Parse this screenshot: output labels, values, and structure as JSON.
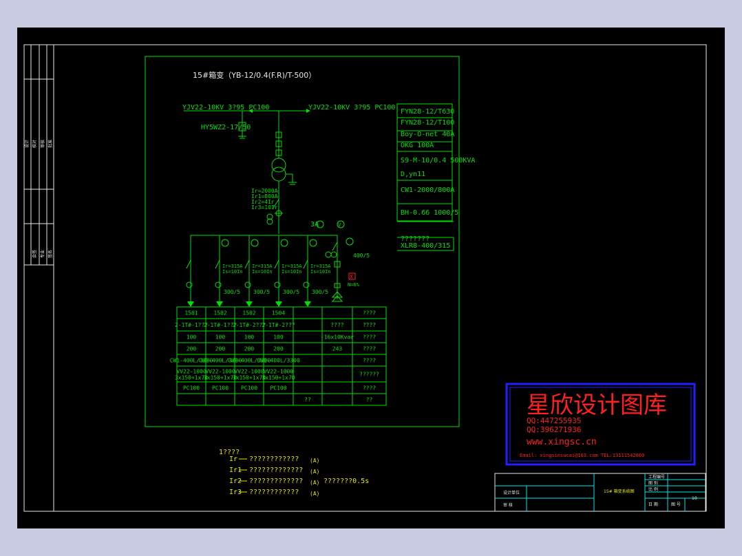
{
  "diagram": {
    "title": "15#箱变（YB-12/0.4(F.R)/T-500）",
    "incoming_left": "YJV22-10KV 3?95 PC100",
    "incoming_right": "YJV22-10KV 3?95 PC100",
    "arrester": "HY5WZ2-17/50",
    "main_settings": [
      "Ir=2000A",
      "Ir1=800A",
      "Ir2=4Ir",
      "Ir3=10Ir"
    ],
    "meters": [
      "3A",
      "V"
    ],
    "branch_settings": [
      "Ir=315A",
      "Is=10In"
    ],
    "ct_label": "300/5",
    "cap_ct_label": "400/5",
    "cap_reactor": "X",
    "cap_note": "N=6%",
    "equipment": [
      "FYN28-12/T630",
      "FYN28-12/T100",
      "Boy-O-net  40A",
      "OKG 100A",
      "S9-M-10/0.4  500KVA",
      "D,yn11",
      "CW1-2000/800A",
      "BH-0.66  1000/5",
      "???????",
      "XLR8-400/315"
    ],
    "table": {
      "rows": [
        [
          "1501",
          "1502",
          "1502",
          "1504",
          "",
          "",
          "????"
        ],
        [
          "2-1T#-1???",
          "2-1T#-1???",
          "2-1T#-2???",
          "2-1T#-2???",
          "",
          "????",
          "????"
        ],
        [
          "100",
          "100",
          "100",
          "100",
          "",
          "-16x10Kvar",
          "????"
        ],
        [
          "200",
          "200",
          "200",
          "200",
          "",
          "243",
          "????"
        ],
        [
          "CW1-400L/3300",
          "CW1-400L/3300",
          "CW1-400L/3300",
          "CW1-400L/3300",
          "",
          "",
          "????"
        ],
        [
          "VV22-1000\n3x150+1x70",
          "VV22-1000\n3x150+1x70",
          "VV22-1000\n3x150+1x70",
          "VV22-1000\n3x150+1x70",
          "",
          "",
          "??????"
        ],
        [
          "PC100",
          "PC100",
          "PC100",
          "PC100",
          "",
          "",
          "????"
        ],
        [
          "",
          "",
          "",
          "",
          "??",
          "",
          "??"
        ]
      ]
    },
    "legend": {
      "title": "1????",
      "items": [
        {
          "sym": "Ir",
          "desc": "????????????",
          "unit": "(A)"
        },
        {
          "sym": "Ir1",
          "desc": "?????????????",
          "unit": "(A)"
        },
        {
          "sym": "Ir2",
          "desc": "?????????????",
          "unit": "(A)",
          "extra": "???????0.5s"
        },
        {
          "sym": "Ir3",
          "desc": "????????????",
          "unit": "(A)"
        }
      ]
    }
  },
  "watermark": {
    "title": "星欣设计图库",
    "qq1": "QQ:447255935",
    "qq2": "QQ:396271936",
    "site": "www.xingsc.cn",
    "contact": "Email: xingsinsucai@163.com   TEL:13111542600"
  },
  "titleblock": {
    "drawing_title": "15# 箱变系统图",
    "left_labels": [
      "设计单位",
      "审 核"
    ],
    "right_labels": [
      "工程编号",
      "图 别",
      "比 例",
      "日 期",
      "图 号"
    ],
    "right_values": [
      "",
      "",
      "",
      "",
      "10"
    ],
    "margin_labels": [
      "设计",
      "校对",
      "审核",
      "批准",
      "会签",
      "专业",
      "签名"
    ]
  },
  "colors": {
    "background": "#c9cbe3",
    "canvas": "#000000",
    "circuit": "#00e000",
    "frame": "#e8e8e8",
    "legend": "#e8e800",
    "watermark": "#ff2020",
    "titleblock": "#00e8e8"
  }
}
